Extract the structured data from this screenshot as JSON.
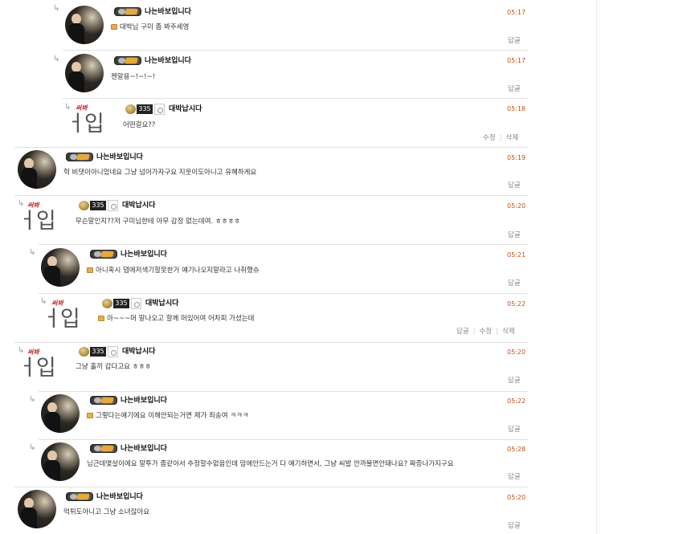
{
  "comments": [
    {
      "name": "나는바보입니다",
      "time": "05:17",
      "text": "대박님 구미 좀 봐주세영",
      "secret": true,
      "avatar": "photo-avatar",
      "actions": [
        "답글"
      ]
    },
    {
      "name": "나는바보입니다",
      "time": "05:17",
      "text": "젠알용~!~!~!",
      "secret": false,
      "avatar": "photo-avatar",
      "actions": [
        "답글"
      ]
    },
    {
      "name": "대박납시다",
      "time": "05:18",
      "text": "어떤걸요??",
      "secret": false,
      "avatar": "handwriting-avatar",
      "level": "335",
      "actions": [
        "수정",
        "삭제"
      ]
    },
    {
      "name": "나는바보입니다",
      "time": "05:19",
      "text": "헉 비댓이아니었네요 그냥 넘어가자구요 지웃이도아니고 유혜하게요",
      "secret": false,
      "avatar": "photo-avatar",
      "actions": [
        "답글"
      ]
    },
    {
      "name": "대박납시다",
      "time": "05:20",
      "text": "무슨말인지??저 구미님한테 아무 감정 없는데여. ㅎㅎㅎㅎ",
      "secret": false,
      "avatar": "handwriting-avatar",
      "level": "335",
      "actions": [
        "답글"
      ]
    },
    {
      "name": "나는바보입니다",
      "time": "05:21",
      "text": "아니혹시 댑에저색기할못한거 얘기나오지말라고 나취했슈",
      "secret": true,
      "avatar": "photo-avatar",
      "actions": [
        "답글"
      ]
    },
    {
      "name": "대박납시다",
      "time": "05:22",
      "text": "아~~~머 말나오고 할께 머있어여 어차피 가셨는데",
      "secret": true,
      "avatar": "handwriting-avatar",
      "level": "335",
      "actions": [
        "답글",
        "수정",
        "삭제"
      ]
    },
    {
      "name": "대박납시다",
      "time": "05:20",
      "text": "그냥 홀끼 갑다고요 ㅎㅎㅎ",
      "secret": false,
      "avatar": "handwriting-avatar",
      "level": "335",
      "actions": [
        "답글"
      ]
    },
    {
      "name": "나는바보입니다",
      "time": "05:22",
      "text": "그렇다는얘기에요 이해안되는거면 제가 죄송여 ㅋㅋㅋ",
      "secret": true,
      "avatar": "photo-avatar",
      "actions": [
        "답글"
      ]
    },
    {
      "name": "나는바보입니다",
      "time": "05:28",
      "text": "님근데몇살이에요 말투가 좀같아서 추정할수없음인데 맘에안드는거 다 얘기하면서, 그냥 씨발 안까불면안돼나요? 짜증나가지구요",
      "secret": false,
      "avatar": "photo-avatar",
      "actions": [
        "답글"
      ]
    },
    {
      "name": "나는바보입니다",
      "time": "05:20",
      "text": "먹튀도아니고 그냥 소녀잖아요",
      "secret": false,
      "avatar": "photo-avatar",
      "actions": [
        "답글"
      ]
    }
  ],
  "icons": {
    "reply_arrow": "↳",
    "secret_icon": "lock-icon",
    "handwriting_small": "써봐",
    "handwriting_big": "ㅓ입"
  }
}
